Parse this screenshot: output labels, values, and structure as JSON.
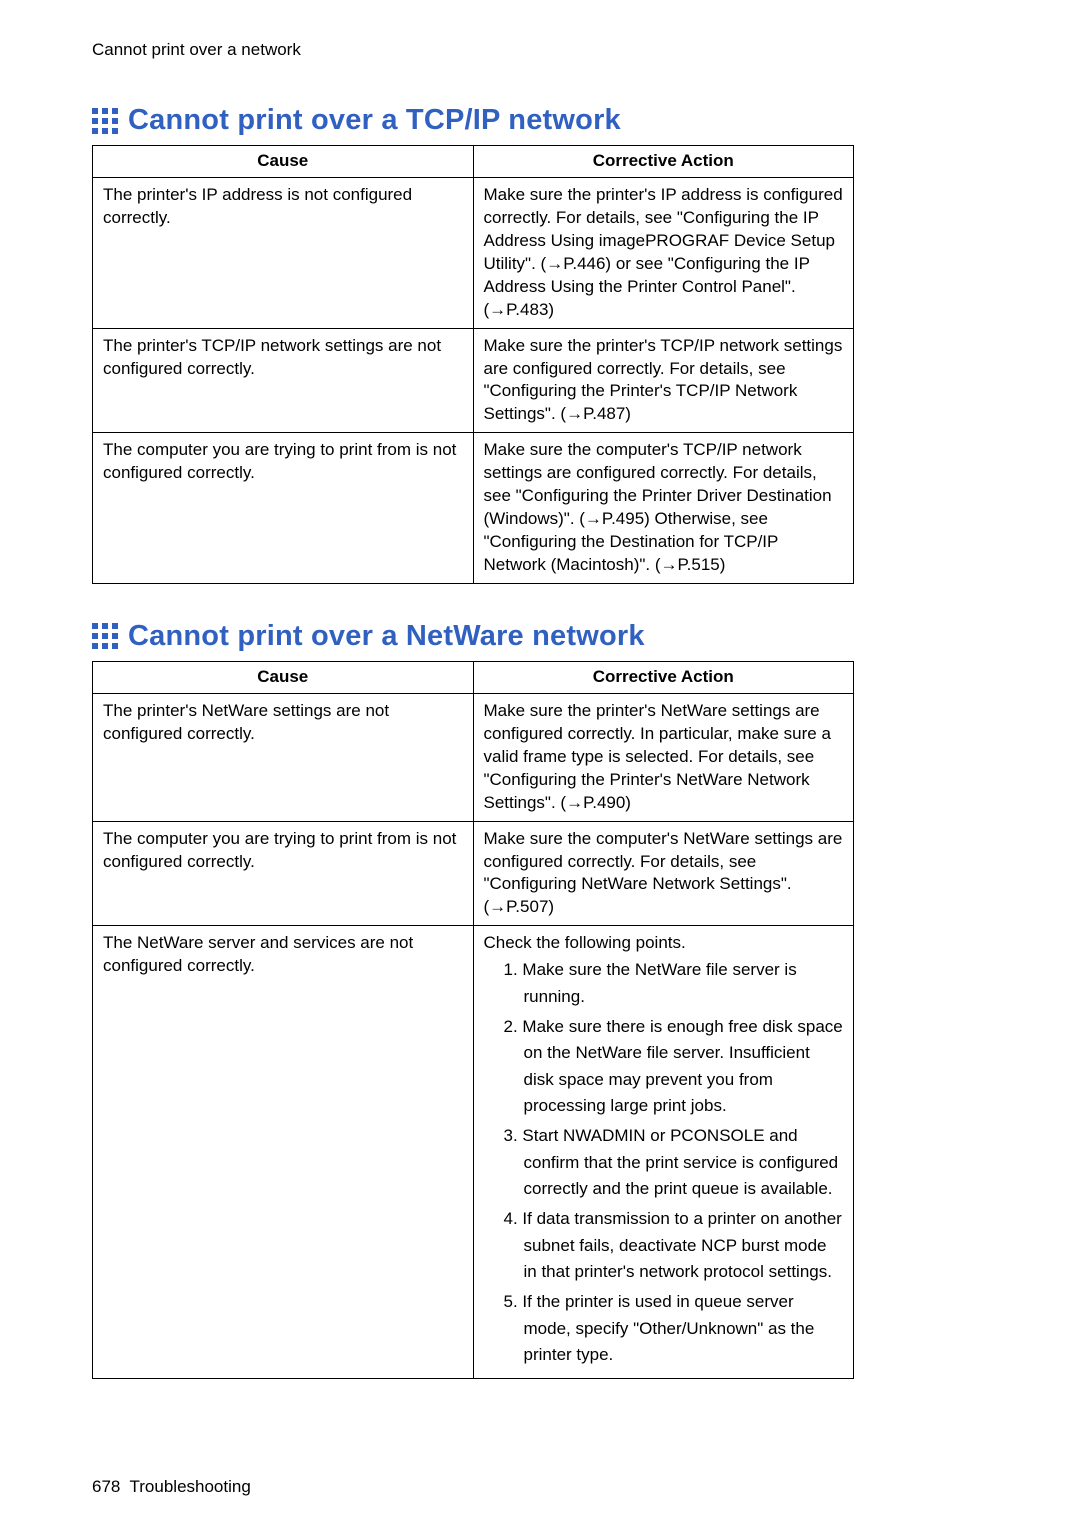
{
  "running_head": "Cannot print over a network",
  "footer": {
    "page_number": "678",
    "section": "Troubleshooting"
  },
  "sections": [
    {
      "title": "Cannot print over a TCP/IP network",
      "headers": {
        "cause": "Cause",
        "action": "Corrective Action"
      },
      "rows": [
        {
          "cause": "The printer's IP address is not configured correctly.",
          "action": "Make sure the printer's IP address is configured correctly.  For details, see \"Configuring the IP Address Using imagePROGRAF Device Setup Utility\". (→P.446) or see \"Configuring the IP Address Using the Printer Control Panel\". (→P.483)"
        },
        {
          "cause": "The printer's TCP/IP network settings are not configured correctly.",
          "action": "Make sure the printer's TCP/IP network settings are configured correctly. For details, see \"Configuring the Printer's TCP/IP Network Settings\". (→P.487)"
        },
        {
          "cause": "The computer you are trying to print from is not configured correctly.",
          "action": "Make sure the computer's TCP/IP network settings are configured correctly. For details, see \"Configuring the Printer Driver Destination (Windows)\". (→P.495) Otherwise, see \"Configuring the Destination for TCP/IP Network (Macintosh)\". (→P.515)"
        }
      ]
    },
    {
      "title": "Cannot print over a NetWare network",
      "headers": {
        "cause": "Cause",
        "action": "Corrective Action"
      },
      "rows": [
        {
          "cause": "The printer's NetWare settings are not configured correctly.",
          "action": "Make sure the printer's NetWare settings are configured correctly. In particular, make sure a valid frame type is selected. For details, see \"Configuring the Printer's NetWare Network Settings\". (→P.490)"
        },
        {
          "cause": "The computer you are trying to print from is not configured correctly.",
          "action": "Make sure the computer's NetWare settings are configured correctly.  For details, see \"Configuring NetWare Network Settings\". (→P.507)"
        },
        {
          "cause": "The NetWare server and services are not configured correctly.",
          "action_intro": "Check the following points.",
          "action_list": [
            "Make sure the NetWare file server is running.",
            "Make sure there is enough free disk space on the NetWare file server.  Insufficient disk space may prevent you from processing large print jobs.",
            "Start NWADMIN or PCONSOLE and confirm that the print service is configured correctly and the print queue is available.",
            "If data transmission to a printer on another subnet fails, deactivate NCP burst mode in that printer's network protocol settings.",
            "If the printer is used in queue server mode, specify \"Other/Unknown\" as the printer type."
          ]
        }
      ]
    }
  ]
}
